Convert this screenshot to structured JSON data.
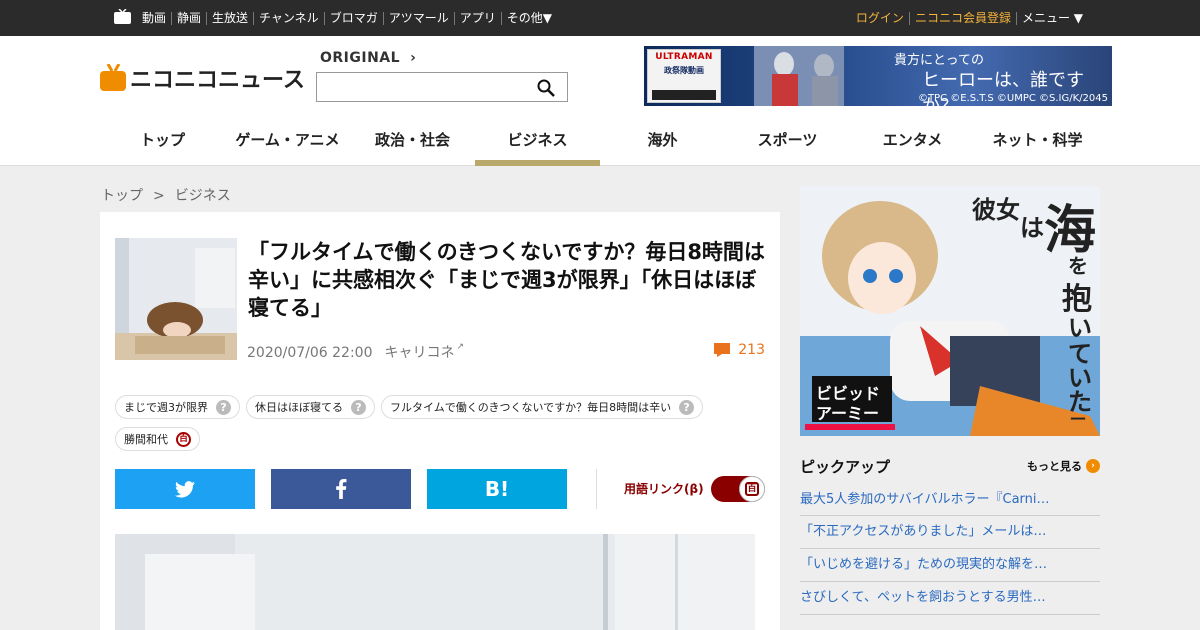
{
  "topbar": {
    "links": [
      "動画",
      "静画",
      "生放送",
      "チャンネル",
      "ブロマガ",
      "アツマール",
      "アプリ",
      "その他▼"
    ],
    "login": "ログイン",
    "register": "ニコニコ会員登録",
    "menu": "メニュー ▼"
  },
  "header": {
    "logo_text": "ニコニコニュース",
    "original_label": "ORIGINAL",
    "search_placeholder": "",
    "banner": {
      "brand": "ULTRAMAN",
      "sub": "政祭隊動画",
      "tagline_top": "貴方にとっての",
      "tagline_main": "ヒーローは、誰ですか？",
      "copyright": "©TPC ©E.S.T.S ©UMPC ©S.IG/K/2045"
    }
  },
  "nav": {
    "tabs": [
      "トップ",
      "ゲーム・アニメ",
      "政治・社会",
      "ビジネス",
      "海外",
      "スポーツ",
      "エンタメ",
      "ネット・科学"
    ],
    "active_index": 3
  },
  "breadcrumb": {
    "home": "トップ",
    "separator": ">",
    "current": "ビジネス"
  },
  "article": {
    "headline": "「フルタイムで働くのきつくないですか？毎日8時間は辛い」に共感相次ぐ「まじで週3が限界」「休日はほぼ寝てる」",
    "date": "2020/07/06 22:00",
    "source": "キャリコネ",
    "comment_count": "213",
    "tags": [
      {
        "label": "まじで週3が限界",
        "mark": "?"
      },
      {
        "label": "休日はほぼ寝てる",
        "mark": "?"
      },
      {
        "label": "フルタイムで働くのきつくないですか？毎日8時間は辛い",
        "mark": "?"
      },
      {
        "label": "勝間和代",
        "mark": "百"
      }
    ],
    "share": {
      "twitter": "t",
      "facebook": "f",
      "hatena": "B!"
    },
    "term_link_label": "用語リンク(β)",
    "toggle_mark": "百",
    "toggle_on": true
  },
  "sidebar": {
    "ad": {
      "title_chars": [
        "彼",
        "女",
        "は",
        "海",
        "を",
        "抱",
        "い",
        "て",
        "い",
        "た",
        "—"
      ],
      "brand_top": "ビビッド",
      "brand_bottom": "アーミー"
    },
    "pickup_title": "ピックアップ",
    "more_label": "もっと見る",
    "pickup_items": [
      "最大5人参加のサバイバルホラー『Carni…",
      "「不正アクセスがありました」メールは…",
      "「いじめを避ける」ための現実的な解を…",
      "さびしくて、ペットを飼おうとする男性…"
    ]
  },
  "colors": {
    "topbar_bg": "#2b2b2b",
    "accent_gold": "#f5b33a",
    "active_tab_underline": "#b8a96a",
    "comment_orange": "#e8731c",
    "twitter": "#1da1f2",
    "facebook": "#3b5998",
    "hatena": "#00a4de",
    "dic_red": "#8a0000",
    "link_blue": "#2a6ac0"
  }
}
